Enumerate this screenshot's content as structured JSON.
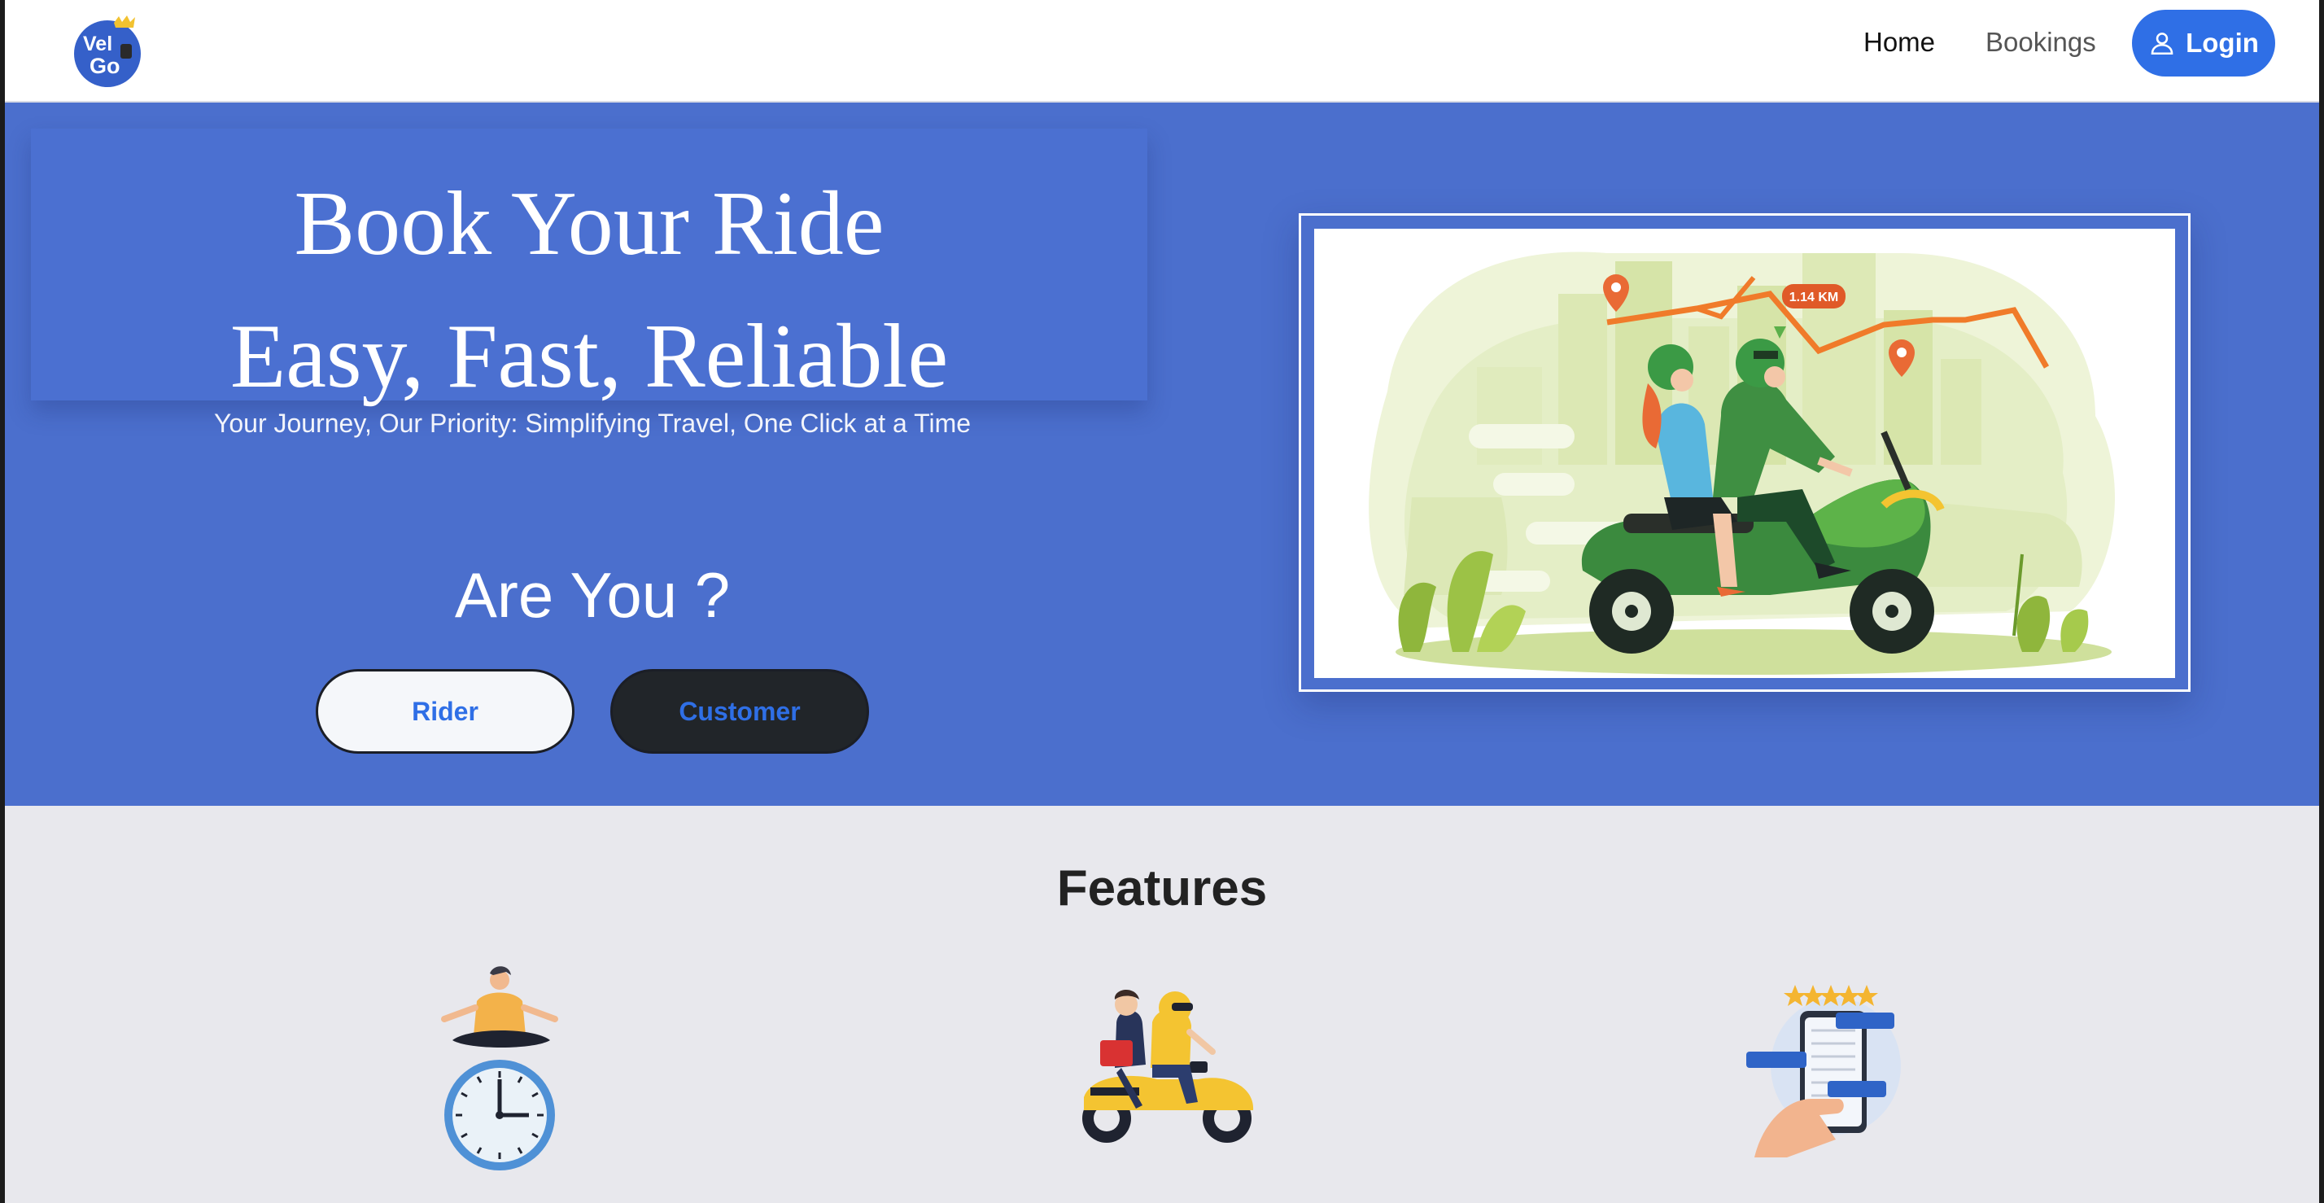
{
  "navbar": {
    "logo_text_top": "Vel",
    "logo_text_bottom": "Go",
    "logo_icon": "crowned-logo-icon",
    "home_label": "Home",
    "bookings_label": "Bookings",
    "login_label": "Login",
    "login_icon": "user-icon",
    "accent": "#2f6fe6"
  },
  "hero": {
    "title_line1": "Book Your Ride",
    "title_line2": "Easy, Fast, Reliable",
    "subtitle": "Your Journey, Our Priority: Simplifying Travel, One Click at a Time",
    "question": "Are You ?",
    "rider_label": "Rider",
    "customer_label": "Customer",
    "illustration": "scooter-ride-illustration",
    "distance_badge": "1.14 KM",
    "background": "#4b6fcd"
  },
  "features": {
    "title": "Features",
    "icons": [
      "clock-meditation-icon",
      "motorbike-taxi-icon",
      "phone-reviews-icon"
    ]
  }
}
